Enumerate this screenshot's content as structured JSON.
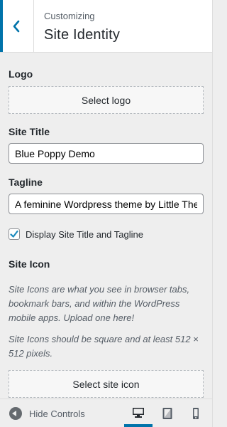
{
  "header": {
    "eyebrow": "Customizing",
    "title": "Site Identity"
  },
  "logo": {
    "label": "Logo",
    "button": "Select logo"
  },
  "site_title": {
    "label": "Site Title",
    "value": "Blue Poppy Demo"
  },
  "tagline": {
    "label": "Tagline",
    "value": "A feminine Wordpress theme by Little Themes"
  },
  "display_toggle": {
    "label": "Display Site Title and Tagline",
    "checked": true
  },
  "site_icon": {
    "label": "Site Icon",
    "description_1": "Site Icons are what you see in browser tabs, bookmark bars, and within the WordPress mobile apps. Upload one here!",
    "description_2": "Site Icons should be square and at least 512 × 512 pixels.",
    "button": "Select site icon"
  },
  "footer": {
    "hide_controls": "Hide Controls",
    "devices": [
      "desktop-icon",
      "tablet-icon",
      "mobile-icon"
    ],
    "active_device": "desktop"
  },
  "colors": {
    "accent": "#0073aa"
  }
}
